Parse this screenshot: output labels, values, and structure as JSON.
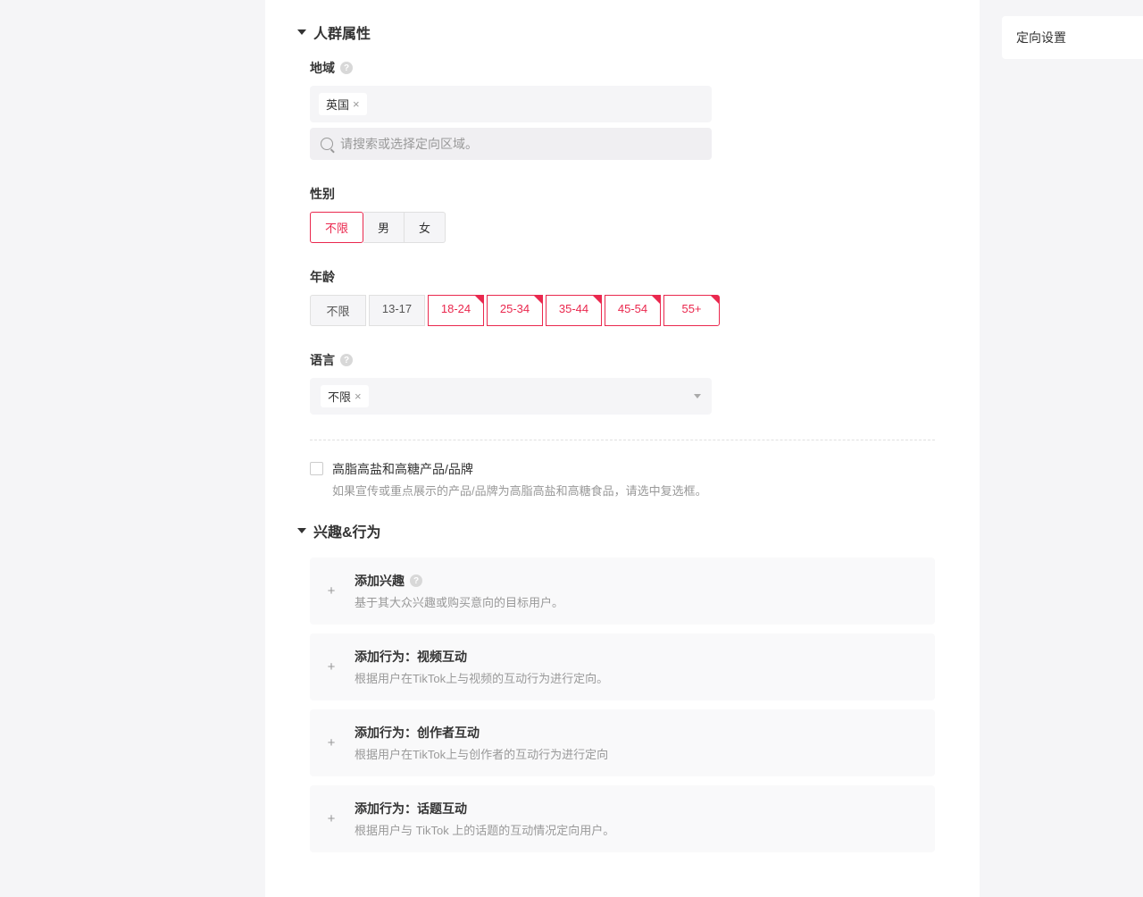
{
  "sections": {
    "audience": {
      "title": "人群属性",
      "region": {
        "label": "地域",
        "tag": "英国",
        "placeholder": "请搜索或选择定向区域。"
      },
      "gender": {
        "label": "性别",
        "options": {
          "any": "不限",
          "male": "男",
          "female": "女"
        }
      },
      "age": {
        "label": "年龄",
        "options": {
          "any": "不限",
          "r1": "13-17",
          "r2": "18-24",
          "r3": "25-34",
          "r4": "35-44",
          "r5": "45-54",
          "r6": "55+"
        }
      },
      "language": {
        "label": "语言",
        "tag": "不限"
      },
      "hfss": {
        "title": "高脂高盐和高糖产品/品牌",
        "desc": "如果宣传或重点展示的产品/品牌为高脂高盐和高糖食品，请选中复选框。"
      }
    },
    "interest": {
      "title": "兴趣&行为",
      "cards": {
        "interest": {
          "title": "添加兴趣",
          "desc": "基于其大众兴趣或购买意向的目标用户。"
        },
        "video": {
          "title": "添加行为：视频互动",
          "desc": "根据用户在TikTok上与视频的互动行为进行定向。"
        },
        "creator": {
          "title": "添加行为：创作者互动",
          "desc": "根据用户在TikTok上与创作者的互动行为进行定向"
        },
        "hashtag": {
          "title": "添加行为：话题互动",
          "desc": "根据用户与 TikTok 上的话题的互动情况定向用户。"
        }
      }
    }
  },
  "rightPanel": {
    "title": "定向设置"
  }
}
